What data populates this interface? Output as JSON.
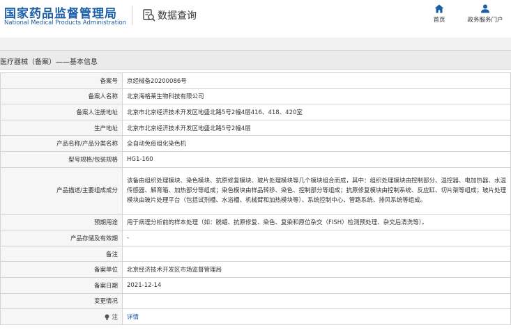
{
  "header": {
    "logo_cn": "国家药品监督管理局",
    "logo_en": "National Medical Products Administration",
    "query_title": "数据查询",
    "nav": [
      {
        "label": "首页",
        "icon": "home-icon"
      },
      {
        "label": "政务服务门户",
        "icon": "user-icon"
      }
    ]
  },
  "breadcrumb": "医疗器械（备案）——基本信息",
  "rows": [
    {
      "label": "备案号",
      "value": "京经械备20200086号"
    },
    {
      "label": "备案人名称",
      "value": "北京海格莱生物科技有限公司"
    },
    {
      "label": "备案人注册地址",
      "value": "北京市北京经济技术开发区地盛北路5号2幢4层416、418、420室"
    },
    {
      "label": "生产地址",
      "value": "北京市北京经济技术开发区地盛北路5号2幢4层"
    },
    {
      "label": "产品名称/产品分类名称",
      "value": "全自动免疫组化染色机"
    },
    {
      "label": "型号规格/包装规格",
      "value": "HG1-160"
    },
    {
      "label": "产品描述/主要组成成分",
      "value": "该备由组织处理模块、染色模块、抗原修复模块、玻片处理模块等几个模块组合而成，其中：组织处理模块由控制部分、温控器、电加热器、水温传感器、解育箱、加热部分等组成；染色模块由样品转移、染色、控制部分等组成；抗原修复模块由控制系统、反应缸、切片架等组成；玻片处理模块由玻片处理平台（包括试剂槽、水浴槽、机械臂和加热模块等）、系统控制中心、管路系统、排风系统等组成。"
    },
    {
      "label": "预期用途",
      "value": "用于病理分析前的样本处理（如：脱蜡、抗原修复、染色、复染和原位杂交（FISH）检测预处理、杂交后清洗等）。"
    },
    {
      "label": "产品存储及有效期",
      "value": "-"
    },
    {
      "label": "备注",
      "value": ""
    },
    {
      "label": "备案单位",
      "value": "北京经济技术开发区市场监督管理局"
    },
    {
      "label": "备案日期",
      "value": "2021-12-14"
    },
    {
      "label": "变更情况",
      "value": ""
    },
    {
      "label": "注",
      "value": "详情"
    }
  ]
}
